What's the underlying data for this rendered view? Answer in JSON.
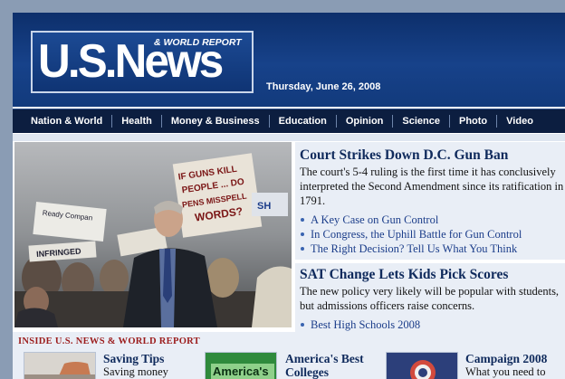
{
  "logo": {
    "main": "U.S.News",
    "sub": "& WORLD REPORT"
  },
  "date": "Thursday, June 26, 2008",
  "nav": [
    "Nation & World",
    "Health",
    "Money & Business",
    "Education",
    "Opinion",
    "Science",
    "Photo",
    "Video"
  ],
  "hero": {
    "signs": [
      "IF GUNS KILL",
      "PEOPLE ... DO",
      "PENS MISSPELL",
      "WORDS?",
      "Ready Compan",
      "INFRINGED",
      "SH"
    ]
  },
  "stories": [
    {
      "headline": "Court Strikes Down D.C. Gun Ban",
      "dek": "The court's 5-4 ruling is the first time it has conclusively interpreted the Second Amendment since its ratification in 1791.",
      "links": [
        "A Key Case on Gun Control",
        "In Congress, the Uphill Battle for Gun Control",
        "The Right Decision? Tell Us What You Think"
      ]
    },
    {
      "headline": "SAT Change Lets Kids Pick Scores",
      "dek": "The new policy very likely will be popular with students, but admissions officers raise concerns.",
      "links": [
        "Best High Schools 2008"
      ]
    }
  ],
  "inside": {
    "title": "INSIDE U.S. NEWS & WORLD REPORT",
    "promos": [
      {
        "title": "Saving Tips",
        "text": "Saving money",
        "thumb_label": ""
      },
      {
        "title": "America's Best",
        "text": "Colleges",
        "thumb_label": "America's"
      },
      {
        "title": "Campaign 2008",
        "text": "What you need to",
        "thumb_label": ""
      }
    ]
  },
  "colors": {
    "masthead": "#17428a",
    "nav": "#0c1e40",
    "headline": "#0f2a5c",
    "link": "#1b3d8a",
    "inside_title": "#9b1c1c"
  }
}
